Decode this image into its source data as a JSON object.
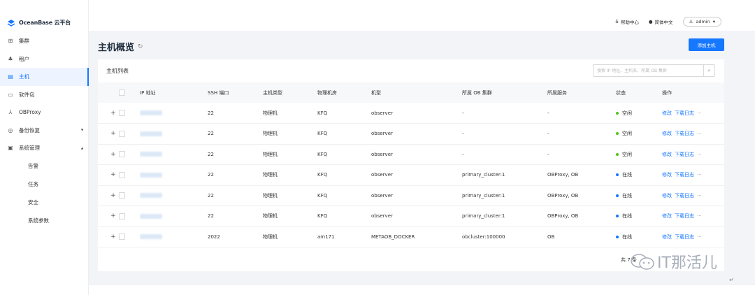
{
  "brand": {
    "name": "OceanBase 云平台"
  },
  "sidebar": {
    "items": [
      {
        "label": "集群",
        "icon": "grid-icon",
        "glyph": "⊞"
      },
      {
        "label": "租户",
        "icon": "org-icon",
        "glyph": "♣"
      },
      {
        "label": "主机",
        "icon": "host-icon",
        "glyph": "▤",
        "active": true
      },
      {
        "label": "软件包",
        "icon": "folder-icon",
        "glyph": "▭"
      },
      {
        "label": "OBProxy",
        "icon": "proxy-icon",
        "glyph": "⅄"
      },
      {
        "label": "备份恢复",
        "icon": "backup-icon",
        "glyph": "◎",
        "chevron": "▾"
      },
      {
        "label": "系统管理",
        "icon": "system-icon",
        "glyph": "▣",
        "chevron": "▴"
      }
    ],
    "sub_items": [
      "告警",
      "任务",
      "安全",
      "系统参数"
    ]
  },
  "topbar": {
    "help": "帮助中心",
    "language": "简体中文",
    "user": "admin"
  },
  "page": {
    "title": "主机概览",
    "add_button": "添加主机"
  },
  "card": {
    "title": "主机列表",
    "search_placeholder": "搜索 IP 地址、主机名、所属 OB 集群"
  },
  "table": {
    "columns": [
      "IP 地址",
      "SSH 端口",
      "主机类型",
      "物理机房",
      "机型",
      "所属 OB 集群",
      "所属服务",
      "状态",
      "操作"
    ],
    "ops": {
      "edit": "修改",
      "log": "下载日志",
      "more": "···"
    },
    "rows": [
      {
        "ssh": "22",
        "type": "物理机",
        "room": "KFQ",
        "model": "observer",
        "cluster": "-",
        "service": "-",
        "status": "空闲",
        "status_color": "#52c41a"
      },
      {
        "ssh": "22",
        "type": "物理机",
        "room": "KFQ",
        "model": "observer",
        "cluster": "-",
        "service": "-",
        "status": "空闲",
        "status_color": "#52c41a"
      },
      {
        "ssh": "22",
        "type": "物理机",
        "room": "KFQ",
        "model": "observer",
        "cluster": "-",
        "service": "-",
        "status": "空闲",
        "status_color": "#52c41a"
      },
      {
        "ssh": "22",
        "type": "物理机",
        "room": "KFQ",
        "model": "observer",
        "cluster": "primary_cluster:1",
        "service": "OBProxy, OB",
        "status": "在线",
        "status_color": "#1677ff"
      },
      {
        "ssh": "22",
        "type": "物理机",
        "room": "KFQ",
        "model": "observer",
        "cluster": "primary_cluster:1",
        "service": "OBProxy, OB",
        "status": "在线",
        "status_color": "#1677ff"
      },
      {
        "ssh": "22",
        "type": "物理机",
        "room": "KFQ",
        "model": "observer",
        "cluster": "primary_cluster:1",
        "service": "OBProxy, OB",
        "status": "在线",
        "status_color": "#1677ff"
      },
      {
        "ssh": "2022",
        "type": "物理机",
        "room": "am171",
        "model": "METAOB_DOCKER",
        "cluster": "obcluster:100000",
        "service": "OB",
        "status": "在线",
        "status_color": "#1677ff"
      }
    ]
  },
  "pager": {
    "text": "共 7 条"
  },
  "watermark": {
    "text": "IT那活儿"
  },
  "colors": {
    "accent": "#1677ff",
    "idle": "#52c41a",
    "online": "#1677ff"
  }
}
